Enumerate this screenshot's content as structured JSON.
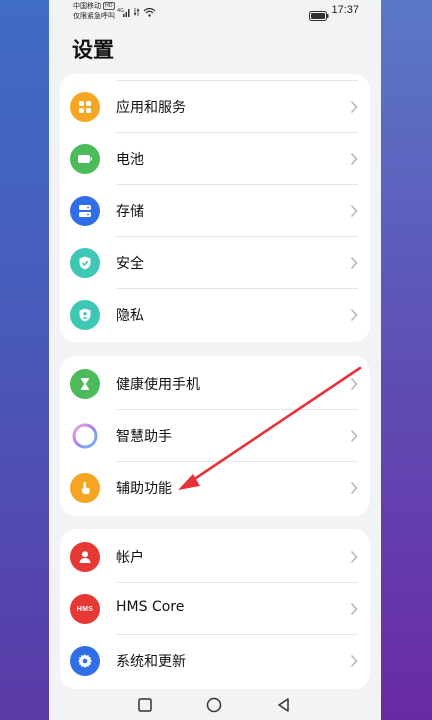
{
  "status": {
    "carrier_line1": "中国移动",
    "carrier_tag": "HD",
    "carrier_line2": "仅限紧急呼叫",
    "time": "17:37"
  },
  "page_title": "设置",
  "group1": [
    {
      "label": "应用和服务",
      "icon": "apps-icon",
      "color": "#f5a623"
    },
    {
      "label": "电池",
      "icon": "battery-icon",
      "color": "#4cbb5c"
    },
    {
      "label": "存储",
      "icon": "storage-icon",
      "color": "#2f6ee6"
    },
    {
      "label": "安全",
      "icon": "shield-icon",
      "color": "#3ec7b4"
    },
    {
      "label": "隐私",
      "icon": "privacy-icon",
      "color": "#3ec7b4"
    }
  ],
  "group2": [
    {
      "label": "健康使用手机",
      "icon": "hourglass-icon",
      "color": "#4cbb5c"
    },
    {
      "label": "智慧助手",
      "icon": "assistant-icon",
      "color": "#ffffff"
    },
    {
      "label": "辅助功能",
      "icon": "accessibility-icon",
      "color": "#f5a623"
    }
  ],
  "group3": [
    {
      "label": "帐户",
      "icon": "account-icon",
      "color": "#e53935"
    },
    {
      "label": "HMS Core",
      "icon": "hms-icon",
      "color": "#e53935",
      "icon_text": "HMS"
    },
    {
      "label": "系统和更新",
      "icon": "settings-gear-icon",
      "color": "#2f6ee6"
    }
  ],
  "annotation_color": "#e53238"
}
